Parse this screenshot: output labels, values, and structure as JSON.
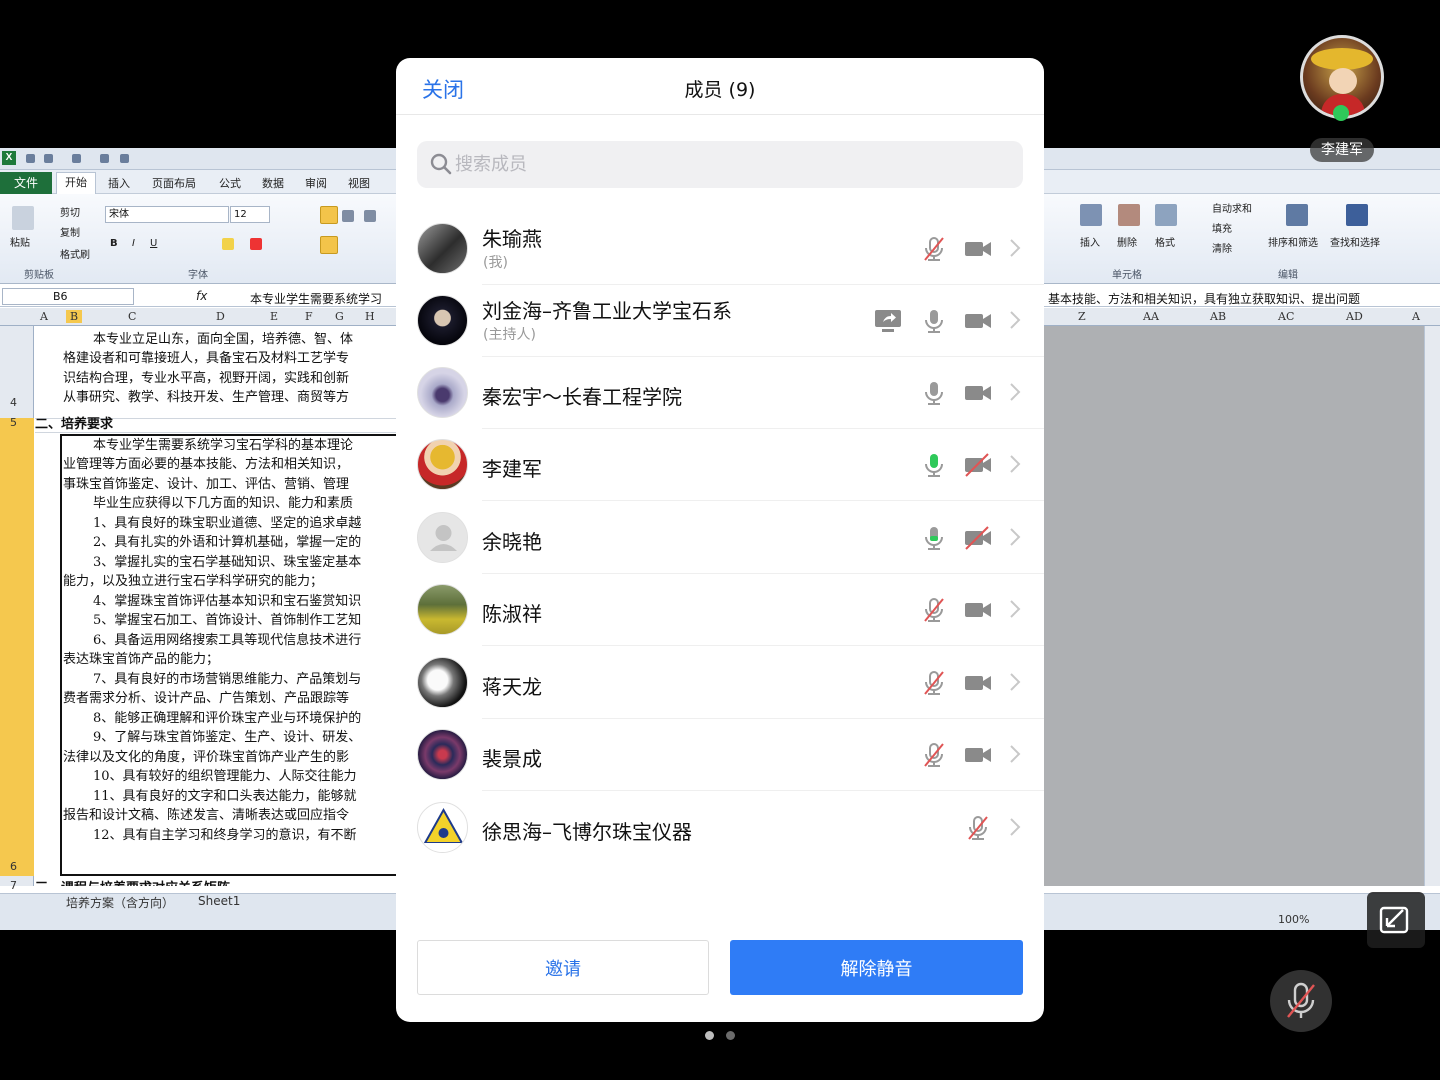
{
  "background": {
    "ribbon_tabs": [
      "文件",
      "开始",
      "插入",
      "页面布局",
      "公式",
      "数据",
      "审阅",
      "视图"
    ],
    "clipboard": {
      "paste": "粘贴",
      "cut": "剪切",
      "copy": "复制",
      "format_painter": "格式刷",
      "group": "剪贴板"
    },
    "font": {
      "name": "宋体",
      "size": "12",
      "group": "字体"
    },
    "cells_group": {
      "insert": "插入",
      "delete": "删除",
      "format": "格式",
      "group": "单元格"
    },
    "editing_group": {
      "autosum": "自动求和",
      "fill": "填充",
      "clear": "清除",
      "sort_filter": "排序和筛选",
      "find_select": "查找和选择",
      "group": "编辑"
    },
    "cell_ref": "B6",
    "formula_left": "本专业学生需要系统学习",
    "formula_right": "基本技能、方法和相关知识，具有独立获取知识、提出问题",
    "columns_left": [
      "A",
      "B",
      "C",
      "D",
      "E",
      "F",
      "G",
      "H"
    ],
    "columns_right": [
      "Z",
      "AA",
      "AB",
      "AC",
      "AD",
      "A"
    ],
    "row_numbers": [
      "4",
      "5",
      "6",
      "7"
    ],
    "sheet_lines": [
      "本专业立足山东，面向全国，培养德、智、体",
      "格建设者和可靠接班人，具备宝石及材料工艺学专",
      "识结构合理，专业水平高，视野开阔，实践和创新",
      "从事研究、教学、科技开发、生产管理、商贸等方",
      "二、培养要求",
      "本专业学生需要系统学习宝石学科的基本理论",
      "业管理等方面必要的基本技能、方法和相关知识，",
      "事珠宝首饰鉴定、设计、加工、评估、营销、管理",
      "毕业生应获得以下几方面的知识、能力和素质",
      "1、具有良好的珠宝职业道德、坚定的追求卓越",
      "2、具有扎实的外语和计算机基础，掌握一定的",
      "3、掌握扎实的宝石学基础知识、珠宝鉴定基本",
      "能力，以及独立进行宝石学科学研究的能力；",
      "4、掌握珠宝首饰评估基本知识和宝石鉴赏知识",
      "5、掌握宝石加工、首饰设计、首饰制作工艺知",
      "6、具备运用网络搜索工具等现代信息技术进行",
      "表达珠宝首饰产品的能力；",
      "7、具有良好的市场营销思维能力、产品策划与",
      "费者需求分析、设计产品、广告策划、产品跟踪等",
      "8、能够正确理解和评价珠宝产业与环境保护的",
      "9、了解与珠宝首饰鉴定、生产、设计、研发、",
      "法律以及文化的角度，评价珠宝首饰产业产生的影",
      "10、具有较好的组织管理能力、人际交往能力",
      "11、具有良好的文字和口头表达能力，能够就",
      "报告和设计文稿、陈述发言、清晰表达或回应指令",
      "12、具有自主学习和终身学习的意识，有不断",
      "三、课程与培养要求对应关系矩阵"
    ],
    "sheet_tabs": [
      "培养方案（含方向）",
      "Sheet1"
    ],
    "zoom": "100%"
  },
  "presenter": {
    "name": "李建军"
  },
  "modal": {
    "close_label": "关闭",
    "title": "成员 (9)",
    "search_placeholder": "搜索成员",
    "members": [
      {
        "name": "朱瑜燕",
        "role": "(我)",
        "mic": "muted",
        "video": "on",
        "share": false
      },
      {
        "name": "刘金海–齐鲁工业大学宝石系",
        "role": "(主持人)",
        "mic": "on",
        "video": "on",
        "share": true
      },
      {
        "name": "秦宏宇～长春工程学院",
        "role": "",
        "mic": "on",
        "video": "on",
        "share": false
      },
      {
        "name": "李建军",
        "role": "",
        "mic": "speaking",
        "video": "off",
        "share": false
      },
      {
        "name": "余晓艳",
        "role": "",
        "mic": "on",
        "video": "off",
        "share": false
      },
      {
        "name": "陈淑祥",
        "role": "",
        "mic": "muted",
        "video": "on",
        "share": false
      },
      {
        "name": "蒋天龙",
        "role": "",
        "mic": "muted",
        "video": "on",
        "share": false
      },
      {
        "name": "裴景成",
        "role": "",
        "mic": "muted",
        "video": "on",
        "share": false
      },
      {
        "name": "徐思海–飞博尔珠宝仪器",
        "role": "",
        "mic": "muted",
        "video": "none",
        "share": false
      }
    ],
    "invite_label": "邀请",
    "unmute_label": "解除静音"
  },
  "colors": {
    "accent": "#2f7cf6",
    "link": "#2a73e8",
    "speaking": "#2ec95a",
    "muted": "#e05555"
  }
}
